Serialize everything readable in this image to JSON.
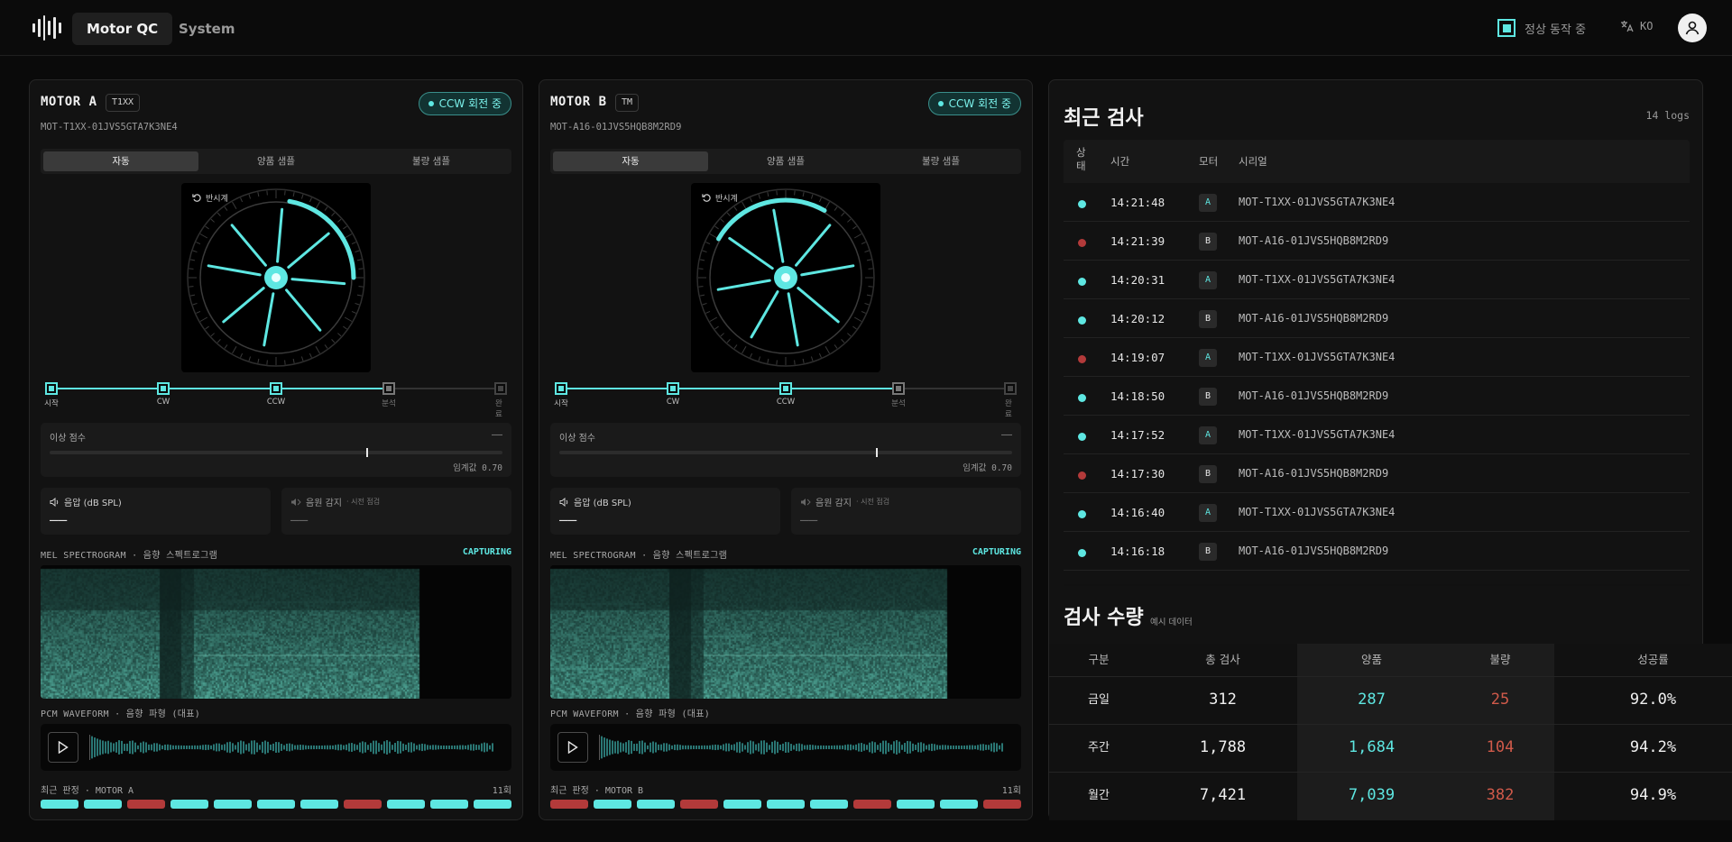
{
  "nav": {
    "tab_active": "Motor QC",
    "tab_system": "System"
  },
  "status": {
    "text": "정상 동작 중"
  },
  "lang": {
    "code": "KO"
  },
  "icons": {
    "logo": "waveform-logo-icon",
    "lang": "translate-icon",
    "user": "user-icon",
    "refresh": "rotate-icon",
    "play": "play-icon",
    "volume": "speaker-icon",
    "source": "speaker-wave-icon"
  },
  "colors": {
    "accent": "#5ee7e2",
    "bad": "#b33a3a",
    "bg": "#0a0a0a"
  },
  "motors": [
    {
      "name": "MOTOR A",
      "chip": "T1XX",
      "rotation": "CCW 회전 중",
      "serial": "MOT-T1XX-01JVS5GTA7K3NE4",
      "segments": [
        "자동",
        "양품 샘플",
        "불량 샘플"
      ],
      "wheel_tag": "반시계",
      "steps": [
        "시작",
        "CW",
        "CCW",
        "분석",
        "완료"
      ],
      "score_label": "이상 점수",
      "score_value": "——",
      "score_marker": 0.7,
      "threshold": "임계값 0.70",
      "spl_label": "음압 (dB SPL)",
      "spl_value": "——",
      "src_label": "음원 감지",
      "src_sub": "· 시전 점검",
      "src_value": "——",
      "spec_label": "MEL SPECTROGRAM · 음향 스펙트로그램",
      "capturing": "CAPTURING",
      "wave_label": "PCM WAVEFORM · 음향 파형 (대표)",
      "recent_label": "최근 판정 · MOTOR A",
      "recent_count": "11회",
      "recent": [
        "ok",
        "ok",
        "bad",
        "ok",
        "ok",
        "ok",
        "ok",
        "bad",
        "ok",
        "ok",
        "ok"
      ]
    },
    {
      "name": "MOTOR B",
      "chip": "TM",
      "rotation": "CCW 회전 중",
      "serial": "MOT-A16-01JVS5HQB8M2RD9",
      "segments": [
        "자동",
        "양품 샘플",
        "불량 샘플"
      ],
      "wheel_tag": "반시계",
      "steps": [
        "시작",
        "CW",
        "CCW",
        "분석",
        "완료"
      ],
      "score_label": "이상 점수",
      "score_value": "——",
      "score_marker": 0.7,
      "threshold": "임계값 0.70",
      "spl_label": "음압 (dB SPL)",
      "spl_value": "——",
      "src_label": "음원 감지",
      "src_sub": "· 시전 점검",
      "src_value": "——",
      "spec_label": "MEL SPECTROGRAM · 음향 스펙트로그램",
      "capturing": "CAPTURING",
      "wave_label": "PCM WAVEFORM · 음향 파형 (대표)",
      "recent_label": "최근 판정 · MOTOR B",
      "recent_count": "11회",
      "recent": [
        "bad",
        "ok",
        "ok",
        "bad",
        "ok",
        "ok",
        "ok",
        "bad",
        "ok",
        "ok",
        "bad"
      ]
    }
  ],
  "recent": {
    "title": "최근 검사",
    "count": "14 logs",
    "headers": {
      "status": "상\n태",
      "time": "시간",
      "motor": "모터",
      "serial": "시리얼"
    },
    "rows": [
      {
        "status": "ok",
        "time": "14:21:48",
        "motor": "A",
        "serial": "MOT-T1XX-01JVS5GTA7K3NE4"
      },
      {
        "status": "bad",
        "time": "14:21:39",
        "motor": "B",
        "serial": "MOT-A16-01JVS5HQB8M2RD9"
      },
      {
        "status": "ok",
        "time": "14:20:31",
        "motor": "A",
        "serial": "MOT-T1XX-01JVS5GTA7K3NE4"
      },
      {
        "status": "ok",
        "time": "14:20:12",
        "motor": "B",
        "serial": "MOT-A16-01JVS5HQB8M2RD9"
      },
      {
        "status": "bad",
        "time": "14:19:07",
        "motor": "A",
        "serial": "MOT-T1XX-01JVS5GTA7K3NE4"
      },
      {
        "status": "ok",
        "time": "14:18:50",
        "motor": "B",
        "serial": "MOT-A16-01JVS5HQB8M2RD9"
      },
      {
        "status": "ok",
        "time": "14:17:52",
        "motor": "A",
        "serial": "MOT-T1XX-01JVS5GTA7K3NE4"
      },
      {
        "status": "bad",
        "time": "14:17:30",
        "motor": "B",
        "serial": "MOT-A16-01JVS5HQB8M2RD9"
      },
      {
        "status": "ok",
        "time": "14:16:40",
        "motor": "A",
        "serial": "MOT-T1XX-01JVS5GTA7K3NE4"
      },
      {
        "status": "ok",
        "time": "14:16:18",
        "motor": "B",
        "serial": "MOT-A16-01JVS5HQB8M2RD9"
      }
    ]
  },
  "volume": {
    "title": "검사 수량",
    "subtitle": "예시 데이터",
    "headers": [
      "구분",
      "총 검사",
      "양품",
      "불량",
      "성공률"
    ],
    "rows": [
      {
        "period": "금일",
        "total": "312",
        "good": "287",
        "bad": "25",
        "rate": "92.0%"
      },
      {
        "period": "주간",
        "total": "1,788",
        "good": "1,684",
        "bad": "104",
        "rate": "94.2%"
      },
      {
        "period": "월간",
        "total": "7,421",
        "good": "7,039",
        "bad": "382",
        "rate": "94.9%"
      }
    ]
  }
}
